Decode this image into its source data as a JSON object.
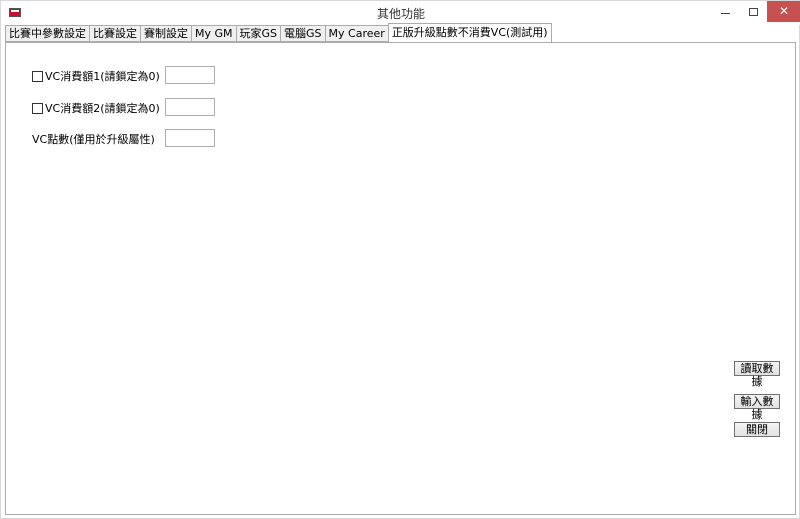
{
  "window": {
    "title": "其他功能"
  },
  "titlebar": {
    "minimize_glyph": "",
    "close_glyph": "✕"
  },
  "tabs": [
    {
      "label": "比賽中參數設定"
    },
    {
      "label": "比賽設定"
    },
    {
      "label": "賽制設定"
    },
    {
      "label": "My GM"
    },
    {
      "label": "玩家GS"
    },
    {
      "label": "電腦GS"
    },
    {
      "label": "My Career"
    },
    {
      "label": "正版升級點數不消費VC(測試用)",
      "active": true
    }
  ],
  "form": {
    "vc1_label": "VC消費額1(請鎖定為0)",
    "vc1_value": "",
    "vc2_label": "VC消費額2(請鎖定為0)",
    "vc2_value": "",
    "vc_points_label": "VC點數(僅用於升級屬性)",
    "vc_points_value": ""
  },
  "actions": {
    "read_label": "讀取數據",
    "write_label": "輸入數據",
    "close_label": "關閉"
  }
}
